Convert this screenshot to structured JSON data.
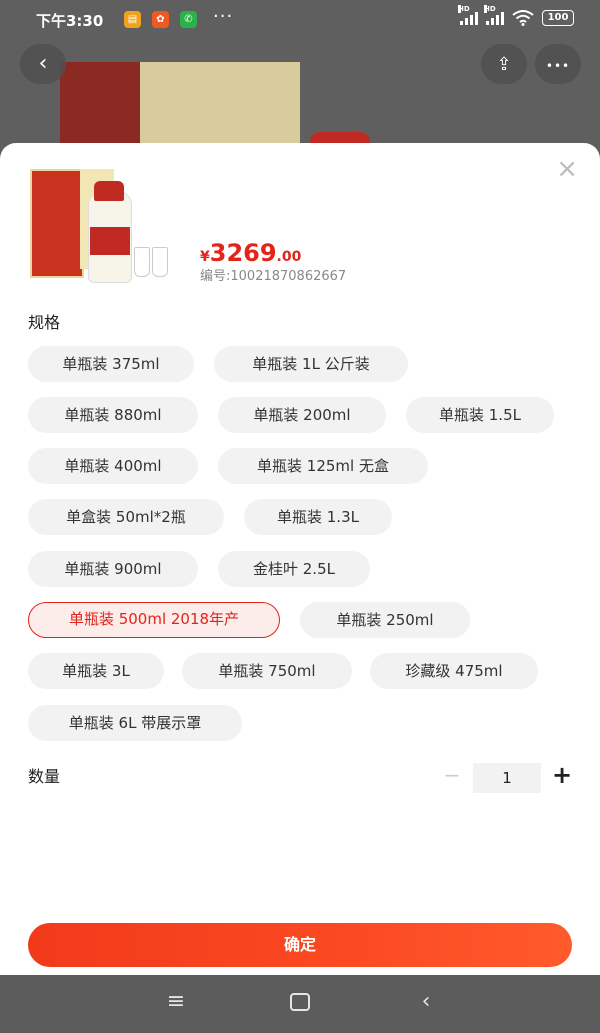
{
  "status_bar": {
    "time": "下午3:30",
    "battery": "100",
    "network": "HD"
  },
  "header": {
    "back_glyph": "‹",
    "share_glyph": "⇪",
    "more_glyph": "•••"
  },
  "sheet": {
    "close_glyph": "×",
    "price": {
      "currency": "¥",
      "integer": "3269",
      "decimal": ".00"
    },
    "sku_number": "编号:10021870862667",
    "spec_title": "规格",
    "options": [
      "单瓶装 375ml",
      "单瓶装 1L 公斤装",
      "单瓶装 880ml",
      "单瓶装 200ml",
      "单瓶装 1.5L",
      "单瓶装 400ml",
      "单瓶装 125ml 无盒",
      "单盒装 50ml*2瓶",
      "单瓶装 1.3L",
      "单瓶装 900ml",
      "金桂叶 2.5L",
      "单瓶装 500ml 2018年产",
      "单瓶装 250ml",
      "单瓶装 3L",
      "单瓶装 750ml",
      "珍藏级 475ml",
      "单瓶装 6L 带展示罩"
    ],
    "selected_option": "单瓶装 500ml 2018年产",
    "quantity_title": "数量",
    "quantity": "1",
    "minus_glyph": "−",
    "plus_glyph": "+",
    "confirm_label": "确定"
  },
  "nav": {
    "menu_glyph": "≡",
    "back_glyph": "‹"
  },
  "colors": {
    "accent": "#e1251b",
    "chip_bg": "#f2f2f2",
    "selected_bg": "#fcecea"
  }
}
